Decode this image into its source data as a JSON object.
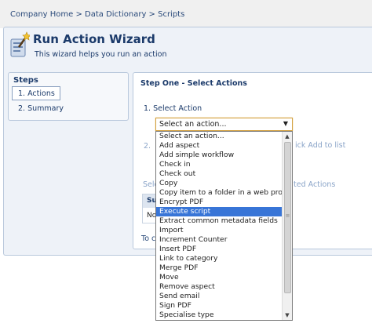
{
  "breadcrumb": {
    "text": "Company Home > Data Dictionary > Scripts"
  },
  "wizard": {
    "title": "Run Action Wizard",
    "description": "This wizard helps you run an action",
    "icon": "wizard-wand-icon"
  },
  "steps": {
    "heading": "Steps",
    "items": [
      {
        "label": "1. Actions"
      },
      {
        "label": "2. Summary"
      }
    ]
  },
  "main": {
    "step_title": "Step One - Select Actions",
    "select_label": "1.  Select Action",
    "partial_step2": "2.",
    "partial_hint": "ick Add to list",
    "partial_selected": "Sele",
    "partial_actions": "ted Actions",
    "table_header": "Su",
    "table_cell": "No",
    "partial_continue": "To c"
  },
  "action_select": {
    "value": "Select an action...",
    "options": [
      "Select an action...",
      "Add aspect",
      "Add simple workflow",
      "Check in",
      "Check out",
      "Copy",
      "Copy item to a folder in a web project",
      "Encrypt PDF",
      "Execute script",
      "Extract common metadata fields",
      "Import",
      "Increment Counter",
      "Insert PDF",
      "Link to category",
      "Merge PDF",
      "Move",
      "Remove aspect",
      "Send email",
      "Sign PDF",
      "Specialise type"
    ],
    "highlighted_index": 8
  },
  "colors": {
    "accent": "#1b3a6a",
    "highlight": "#3875d7",
    "panel_border": "#b9c8dc",
    "focus_border": "#d2a040"
  }
}
